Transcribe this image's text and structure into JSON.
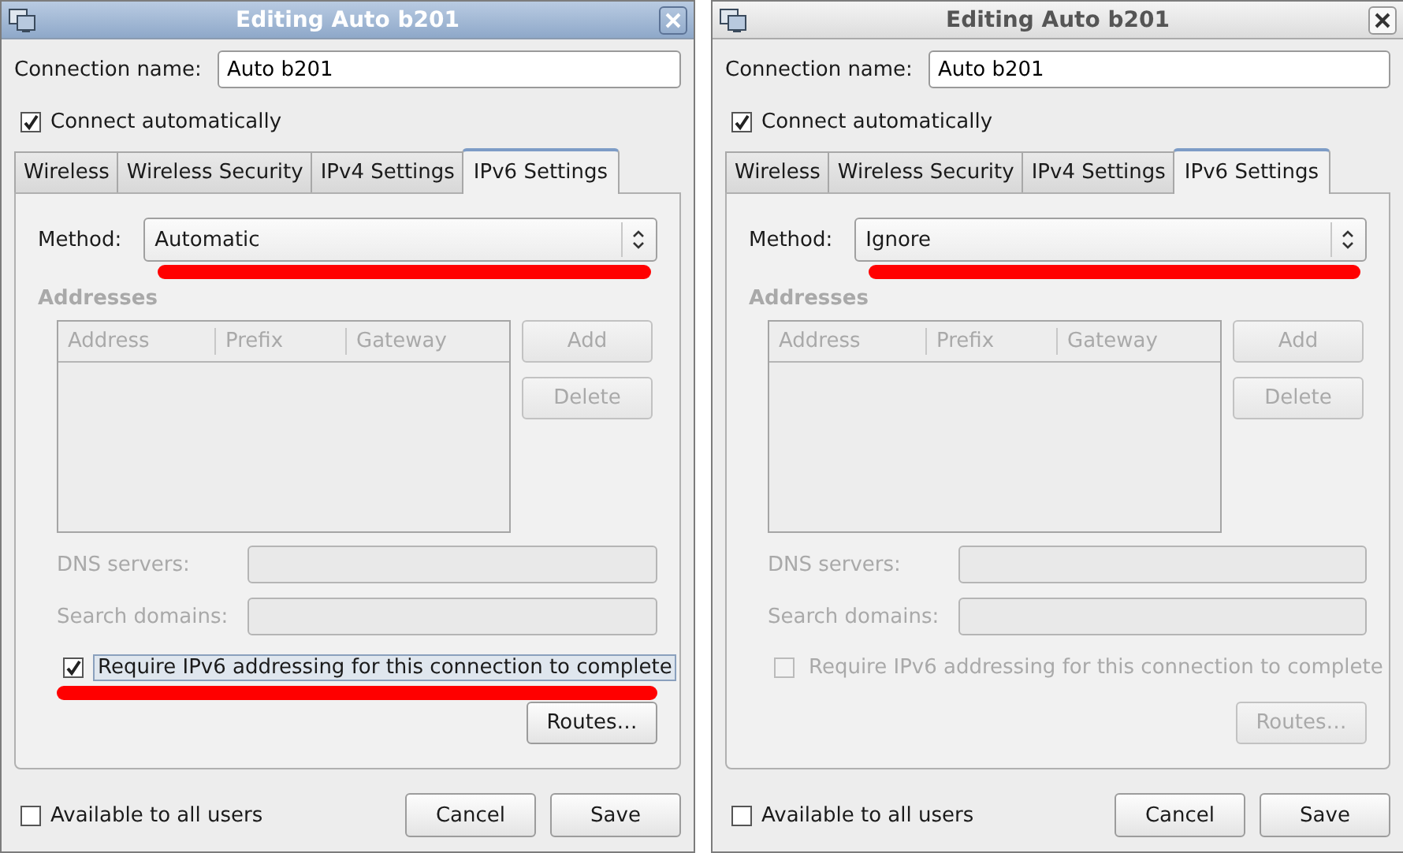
{
  "windows": [
    {
      "title": "Editing Auto b201",
      "active": true,
      "connection_name_label": "Connection name:",
      "connection_name": "Auto b201",
      "connect_automatically": {
        "label": "Connect automatically",
        "checked": true
      },
      "tabs": [
        {
          "label": "Wireless",
          "selected": false
        },
        {
          "label": "Wireless Security",
          "selected": false
        },
        {
          "label": "IPv4 Settings",
          "selected": false
        },
        {
          "label": "IPv6 Settings",
          "selected": true
        }
      ],
      "method": {
        "label": "Method:",
        "value": "Automatic",
        "highlighted": true
      },
      "addresses": {
        "title": "Addresses",
        "columns": [
          "Address",
          "Prefix",
          "Gateway"
        ],
        "disabled": true
      },
      "add_button": {
        "label": "Add",
        "disabled": true
      },
      "delete_button": {
        "label": "Delete",
        "disabled": true
      },
      "dns_servers": {
        "label": "DNS servers:",
        "disabled": true
      },
      "search_domains": {
        "label": "Search domains:",
        "disabled": true
      },
      "require_ipv6": {
        "label": "Require IPv6 addressing for this connection to complete",
        "checked": true,
        "disabled": false,
        "focused": true,
        "highlighted": true
      },
      "routes_button": {
        "label": "Routes…",
        "disabled": false
      },
      "available_to_all_users": {
        "label": "Available to all users",
        "checked": false
      },
      "buttons": [
        "Cancel",
        "Save"
      ]
    },
    {
      "title": "Editing Auto b201",
      "active": false,
      "connection_name_label": "Connection name:",
      "connection_name": "Auto b201",
      "connect_automatically": {
        "label": "Connect automatically",
        "checked": true
      },
      "tabs": [
        {
          "label": "Wireless",
          "selected": false
        },
        {
          "label": "Wireless Security",
          "selected": false
        },
        {
          "label": "IPv4 Settings",
          "selected": false
        },
        {
          "label": "IPv6 Settings",
          "selected": true
        }
      ],
      "method": {
        "label": "Method:",
        "value": "Ignore",
        "highlighted": true
      },
      "addresses": {
        "title": "Addresses",
        "columns": [
          "Address",
          "Prefix",
          "Gateway"
        ],
        "disabled": true
      },
      "add_button": {
        "label": "Add",
        "disabled": true
      },
      "delete_button": {
        "label": "Delete",
        "disabled": true
      },
      "dns_servers": {
        "label": "DNS servers:",
        "disabled": true
      },
      "search_domains": {
        "label": "Search domains:",
        "disabled": true
      },
      "require_ipv6": {
        "label": "Require IPv6 addressing for this connection to complete",
        "checked": false,
        "disabled": true,
        "focused": false,
        "highlighted": false
      },
      "routes_button": {
        "label": "Routes…",
        "disabled": true
      },
      "available_to_all_users": {
        "label": "Available to all users",
        "checked": false
      },
      "buttons": [
        "Cancel",
        "Save"
      ]
    }
  ]
}
